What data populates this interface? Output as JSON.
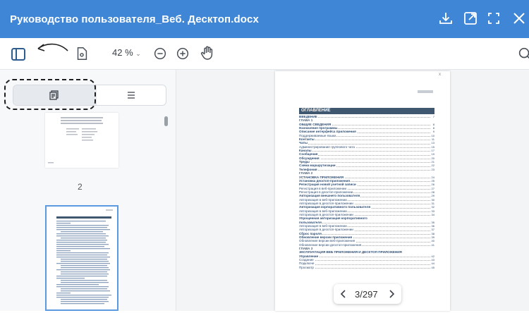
{
  "window": {
    "title": "Руководство пользователя_Веб. Десктоп.docx"
  },
  "toolbar": {
    "zoom": "42 %"
  },
  "sidebar": {
    "thumbnail_page_label": "2"
  },
  "document": {
    "toc_title": "ОГЛАВЛЕНИЕ",
    "toc": [
      {
        "text": "ВВЕДЕНИЕ",
        "num": "7",
        "style": "b"
      },
      {
        "text": "ГЛАВА 1",
        "num": "",
        "style": "h"
      },
      {
        "text": "ОБЩИЕ СВЕДЕНИЯ",
        "num": "8",
        "style": "b"
      },
      {
        "text": "Назначение программы",
        "num": "8",
        "style": "b"
      },
      {
        "text": "Описание интерфейса приложения",
        "num": "9",
        "style": "b"
      },
      {
        "text": "    Поддерживаемые языки",
        "num": "10",
        "style": ""
      },
      {
        "text": "Контакты",
        "num": "11",
        "style": "b"
      },
      {
        "text": "Чаты",
        "num": "13",
        "style": "b"
      },
      {
        "text": "    Администрирование группового чата",
        "num": "15",
        "style": ""
      },
      {
        "text": "Каналы",
        "num": "17",
        "style": "b"
      },
      {
        "text": "Сообщения",
        "num": "19",
        "style": "b"
      },
      {
        "text": "Обсуждения",
        "num": "20",
        "style": "b"
      },
      {
        "text": "Треды",
        "num": "21",
        "style": "b"
      },
      {
        "text": "Схема маршрутизации",
        "num": "22",
        "style": "b"
      },
      {
        "text": "Телефония",
        "num": "23",
        "style": "b"
      },
      {
        "text": "ГЛАВА 2",
        "num": "",
        "style": "h"
      },
      {
        "text": "УСТАНОВКА ПРИЛОЖЕНИЯ",
        "num": "24",
        "style": "b"
      },
      {
        "text": "Установка десктоп-приложения",
        "num": "25",
        "style": "b"
      },
      {
        "text": "Регистрация новой учетной записи",
        "num": "26",
        "style": "b"
      },
      {
        "text": "    Регистрация в веб-приложении",
        "num": "27",
        "style": ""
      },
      {
        "text": "    Регистрация в десктоп-приложении",
        "num": "28",
        "style": ""
      },
      {
        "text": "Авторизация внешнего пользователя",
        "num": "29",
        "style": "b"
      },
      {
        "text": "    Авторизация в веб-приложении",
        "num": "30",
        "style": ""
      },
      {
        "text": "    Авторизация в десктоп-приложении",
        "num": "31",
        "style": ""
      },
      {
        "text": "Авторизация корпоративного пользователя",
        "num": "32",
        "style": "b"
      },
      {
        "text": "    Авторизация в веб-приложении",
        "num": "33",
        "style": ""
      },
      {
        "text": "    Авторизация в десктоп-приложении",
        "num": "34",
        "style": ""
      },
      {
        "text": "Упрощенная авторизация корпоративного",
        "num": "",
        "style": "b"
      },
      {
        "text": "пользователя",
        "num": "35",
        "style": "b"
      },
      {
        "text": "    Авторизация в веб-приложении",
        "num": "36",
        "style": ""
      },
      {
        "text": "    Авторизация в десктоп-приложении",
        "num": "37",
        "style": ""
      },
      {
        "text": "Сброс пароля",
        "num": "38",
        "style": "b"
      },
      {
        "text": "Обновление версии приложения",
        "num": "39",
        "style": "b"
      },
      {
        "text": "    Обновление версии веб-приложения",
        "num": "40",
        "style": ""
      },
      {
        "text": "    Обновление версии десктоп-приложения",
        "num": "41",
        "style": ""
      },
      {
        "text": "ГЛАВА 3",
        "num": "",
        "style": "h"
      },
      {
        "text": "ЭКСПЛУАТАЦИЯ ВЕБ ПРИЛОЖЕНИЯ И ДЕСКТОП ПРИЛОЖЕНИЯ",
        "num": "",
        "style": "b"
      },
      {
        "text": "Управление",
        "num": "42",
        "style": "b"
      },
      {
        "text": "    Создание",
        "num": "43",
        "style": ""
      },
      {
        "text": "    Подключе",
        "num": "44",
        "style": ""
      },
      {
        "text": "    Просмотр",
        "num": "45",
        "style": ""
      }
    ]
  },
  "pager": {
    "current": "3",
    "separator": "/",
    "total": "297"
  },
  "colors": {
    "accent": "#3f86d6",
    "toc_header": "#3f5870",
    "selection": "#5b9ae0"
  }
}
